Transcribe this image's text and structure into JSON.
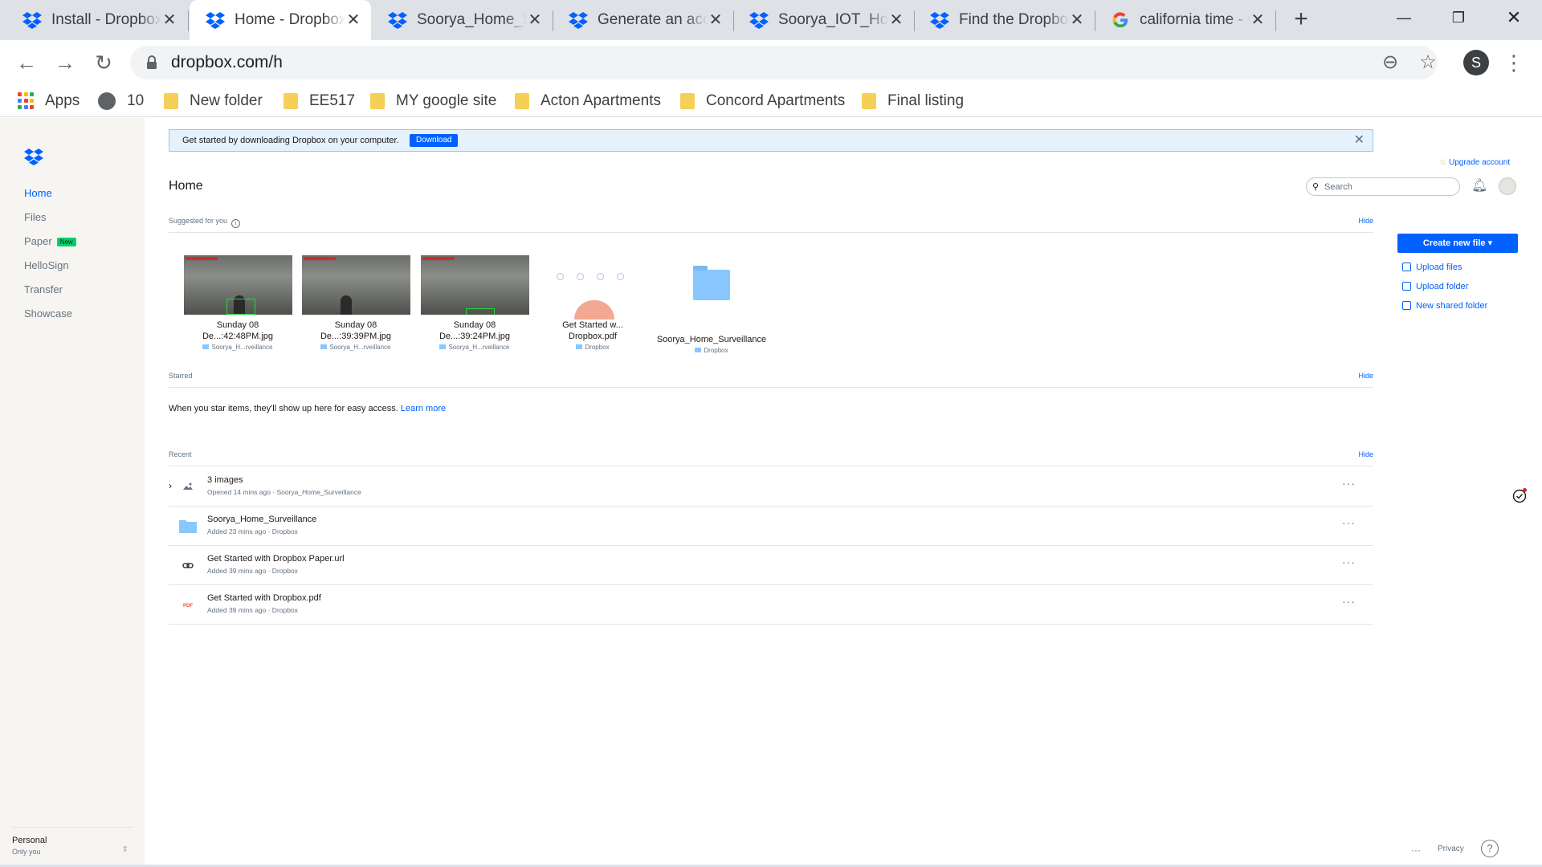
{
  "browser": {
    "tabs": [
      {
        "title": "Install - Dropbox",
        "icon": "dropbox-icon"
      },
      {
        "title": "Home - Dropbox",
        "icon": "dropbox-icon"
      },
      {
        "title": "Soorya_Home_Surveillance",
        "icon": "dropbox-icon"
      },
      {
        "title": "Generate an access token",
        "icon": "dropbox-icon"
      },
      {
        "title": "Soorya_IOT_Home",
        "icon": "dropbox-icon"
      },
      {
        "title": "Find the Dropbox",
        "icon": "dropbox-icon"
      },
      {
        "title": "california time - Google",
        "icon": "google-icon"
      }
    ],
    "url": "dropbox.com/h",
    "profile_initial": "S",
    "bookmarks": [
      {
        "label": "Apps",
        "icon": "apps-grid-icon"
      },
      {
        "label": "10",
        "icon": "globe-icon"
      },
      {
        "label": "New folder",
        "icon": "folder-icon"
      },
      {
        "label": "EE517",
        "icon": "folder-icon"
      },
      {
        "label": "MY google site",
        "icon": "folder-icon"
      },
      {
        "label": "Acton Apartments",
        "icon": "folder-icon"
      },
      {
        "label": "Concord Apartments",
        "icon": "folder-icon"
      },
      {
        "label": "Final listing",
        "icon": "folder-icon"
      }
    ]
  },
  "sidebar": {
    "items": [
      {
        "label": "Home"
      },
      {
        "label": "Files"
      },
      {
        "label": "Paper",
        "badge": "New"
      },
      {
        "label": "HelloSign"
      },
      {
        "label": "Transfer"
      },
      {
        "label": "Showcase"
      }
    ],
    "account": {
      "name": "Personal",
      "sub": "Only you"
    }
  },
  "banner": {
    "text": "Get started by downloading Dropbox on your computer.",
    "button": "Download",
    "close": "✕"
  },
  "header": {
    "upgrade": "Upgrade account",
    "title": "Home",
    "search_placeholder": "Search"
  },
  "suggested": {
    "label": "Suggested for you",
    "hide": "Hide",
    "items": [
      {
        "name_line1": "Sunday 08",
        "name_line2": "De...:42:48PM.jpg",
        "location": "Soorya_H...rveillance"
      },
      {
        "name_line1": "Sunday 08",
        "name_line2": "De...:39:39PM.jpg",
        "location": "Soorya_H...rveillance"
      },
      {
        "name_line1": "Sunday 08",
        "name_line2": "De...:39:24PM.jpg",
        "location": "Soorya_H...rveillance"
      },
      {
        "name_line1": "Get Started w...",
        "name_line2": "Dropbox.pdf",
        "location": "Dropbox"
      },
      {
        "name_line1": "Soorya_Home_Surveillance",
        "name_line2": "",
        "location": "Dropbox"
      }
    ]
  },
  "starred": {
    "label": "Starred",
    "hide": "Hide",
    "empty_text": "When you star items, they'll show up here for easy access.",
    "learn_more": "Learn more"
  },
  "recent": {
    "label": "Recent",
    "hide": "Hide",
    "rows": [
      {
        "name": "3 images",
        "meta": "Opened 14 mins ago · Soorya_Home_Surveillance",
        "icon": "images-icon"
      },
      {
        "name": "Soorya_Home_Surveillance",
        "meta": "Added 23 mins ago · Dropbox",
        "icon": "folder-icon"
      },
      {
        "name": "Get Started with Dropbox Paper.url",
        "meta": "Added 39 mins ago · Dropbox",
        "icon": "link-icon"
      },
      {
        "name": "Get Started with Dropbox.pdf",
        "meta": "Added 39 mins ago · Dropbox",
        "icon": "pdf-icon"
      }
    ],
    "more": "···"
  },
  "actions": {
    "create": "Create new file ▾",
    "upload_files": "Upload files",
    "upload_folder": "Upload folder",
    "new_shared_folder": "New shared folder"
  },
  "footer": {
    "dots": "···",
    "privacy": "Privacy",
    "help": "?"
  },
  "colors": {
    "accent": "#0061fe",
    "sidebar_bg": "#f7f5f2",
    "folder": "#8ac7ff",
    "badge": "#00d26a"
  }
}
